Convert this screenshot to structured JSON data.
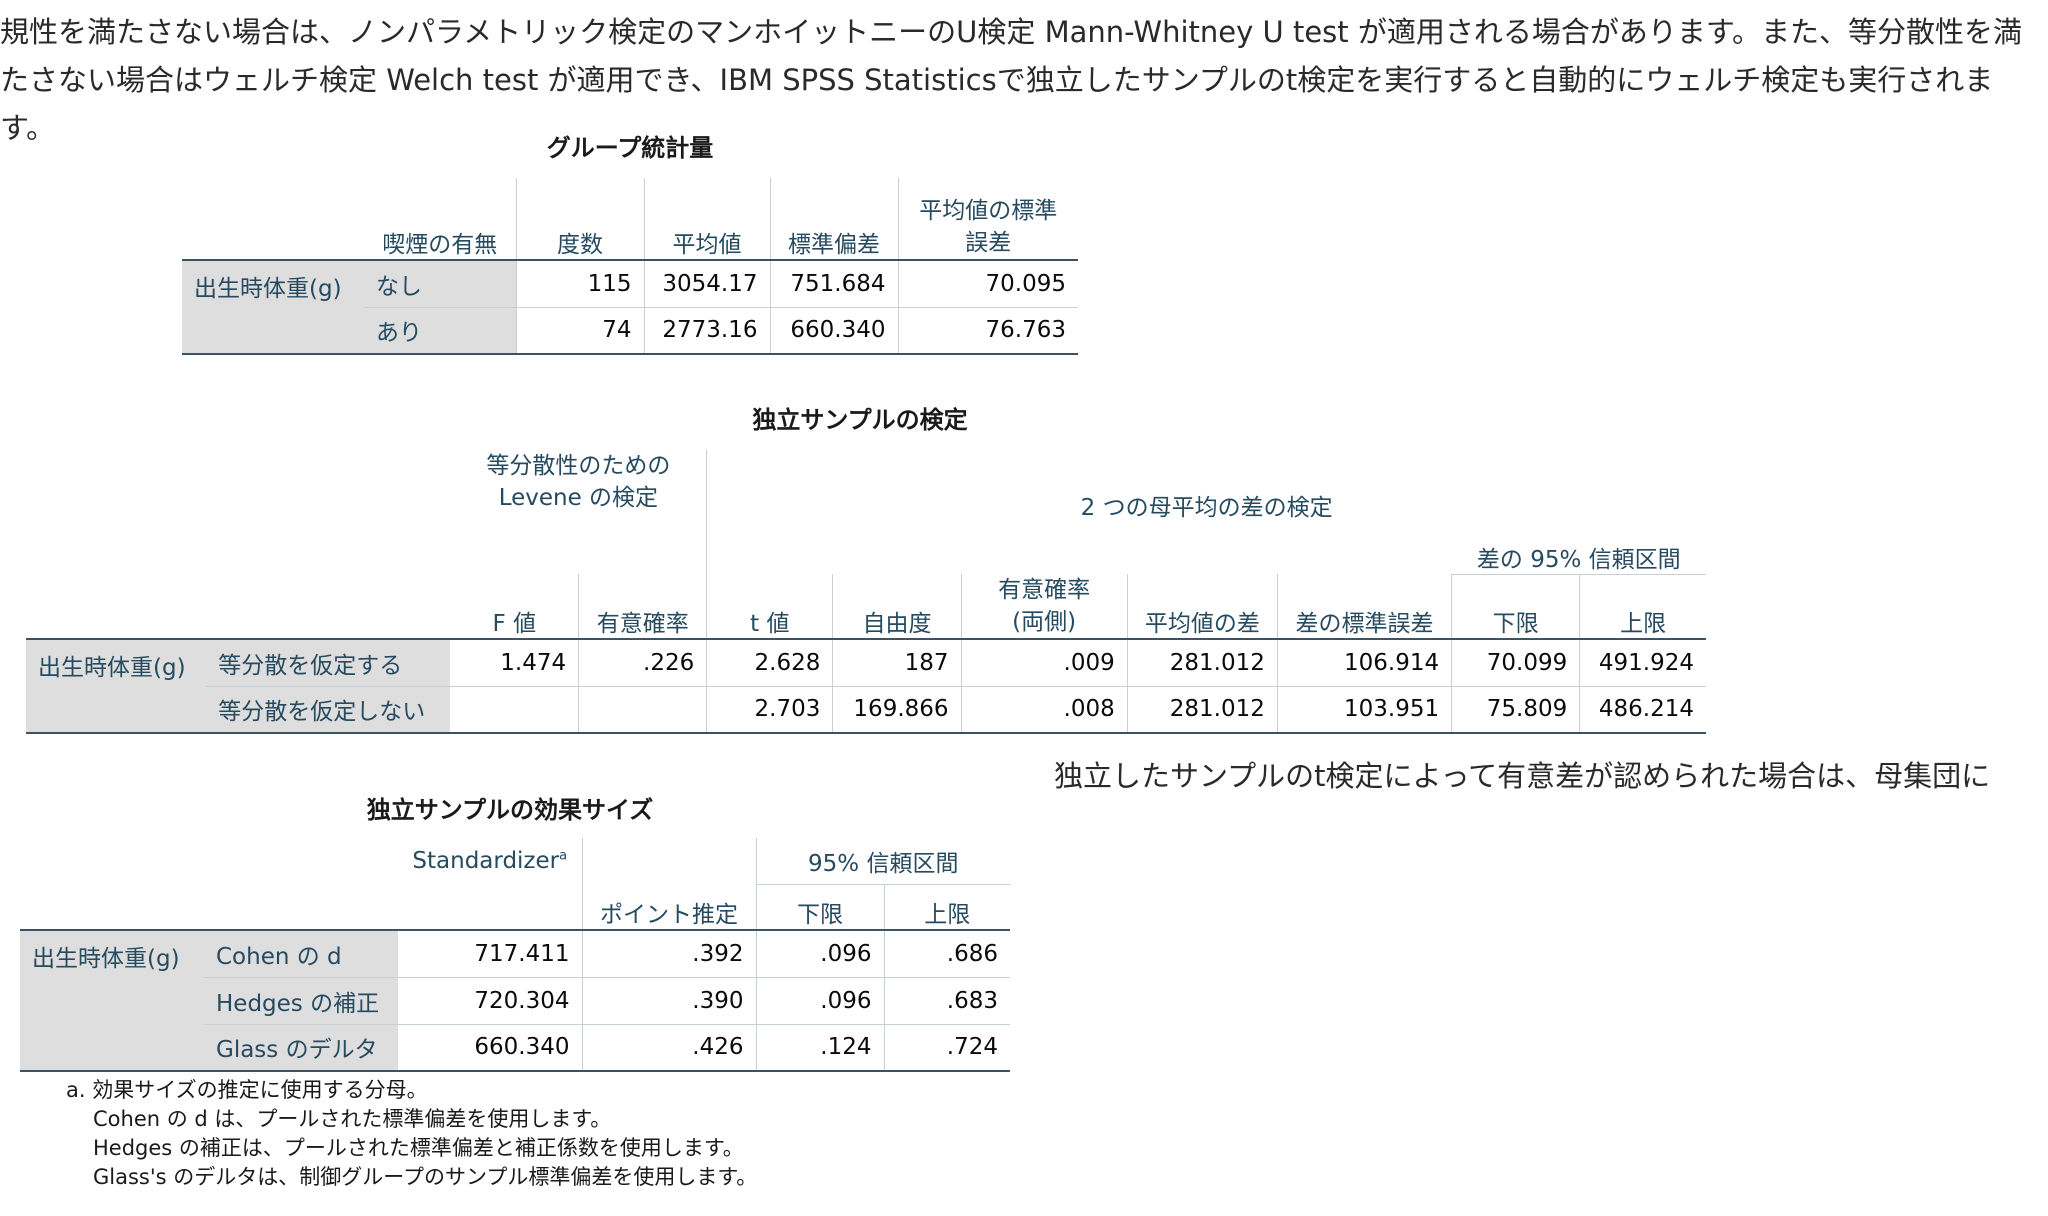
{
  "intro_text": "規性を満たさない場合は、ノンパラメトリック検定のマンホイットニーのU検定 Mann-Whitney U test が適用される場合があります。また、等分散性を満たさない場合はウェルチ検定 Welch test が適用でき、IBM SPSS Statisticsで独立したサンプルのt検定を実行すると自動的にウェルチ検定も実行されます。",
  "side_text": "独立したサンプルのt検定によって有意差が認められた場合は、母集団に",
  "group_stats": {
    "title": "グループ統計量",
    "headers": {
      "smoking": "喫煙の有無",
      "n": "度数",
      "mean": "平均値",
      "sd": "標準偏差",
      "se": "平均値の標準誤差"
    },
    "row_label": "出生時体重(g)",
    "rows": [
      {
        "group": "なし",
        "n": "115",
        "mean": "3054.17",
        "sd": "751.684",
        "se": "70.095"
      },
      {
        "group": "あり",
        "n": "74",
        "mean": "2773.16",
        "sd": "660.340",
        "se": "76.763"
      }
    ]
  },
  "ind_test": {
    "title": "独立サンプルの検定",
    "levene_header": "等分散性のための Levene の検定",
    "ttest_header": "2 つの母平均の差の検定",
    "ci_header": "差の 95% 信頼区間",
    "cols": {
      "f": "F 値",
      "sig": "有意確率",
      "t": "t 値",
      "df": "自由度",
      "sig2": "有意確率 (両側)",
      "mean_diff": "平均値の差",
      "se_diff": "差の標準誤差",
      "lower": "下限",
      "upper": "上限"
    },
    "row_label": "出生時体重(g)",
    "rows": [
      {
        "label": "等分散を仮定する",
        "f": "1.474",
        "sig": ".226",
        "t": "2.628",
        "df": "187",
        "sig2": ".009",
        "mean_diff": "281.012",
        "se_diff": "106.914",
        "lower": "70.099",
        "upper": "491.924"
      },
      {
        "label": "等分散を仮定しない",
        "f": "",
        "sig": "",
        "t": "2.703",
        "df": "169.866",
        "sig2": ".008",
        "mean_diff": "281.012",
        "se_diff": "103.951",
        "lower": "75.809",
        "upper": "486.214"
      }
    ]
  },
  "effect": {
    "title": "独立サンプルの効果サイズ",
    "cols": {
      "standardizer": "Standardizer",
      "standardizer_sup": "a",
      "point": "ポイント推定",
      "ci": "95% 信頼区間",
      "lower": "下限",
      "upper": "上限"
    },
    "row_label": "出生時体重(g)",
    "rows": [
      {
        "label": "Cohen の d",
        "std": "717.411",
        "point": ".392",
        "lower": ".096",
        "upper": ".686"
      },
      {
        "label": "Hedges の補正",
        "std": "720.304",
        "point": ".390",
        "lower": ".096",
        "upper": ".683"
      },
      {
        "label": "Glass のデルタ",
        "std": "660.340",
        "point": ".426",
        "lower": ".124",
        "upper": ".724"
      }
    ],
    "footnotes": [
      "a. 効果サイズの推定に使用する分母。",
      "Cohen の d は、プールされた標準偏差を使用します。",
      "Hedges の補正は、プールされた標準偏差と補正係数を使用します。",
      "Glass's のデルタは、制御グループのサンプル標準偏差を使用します。"
    ]
  }
}
